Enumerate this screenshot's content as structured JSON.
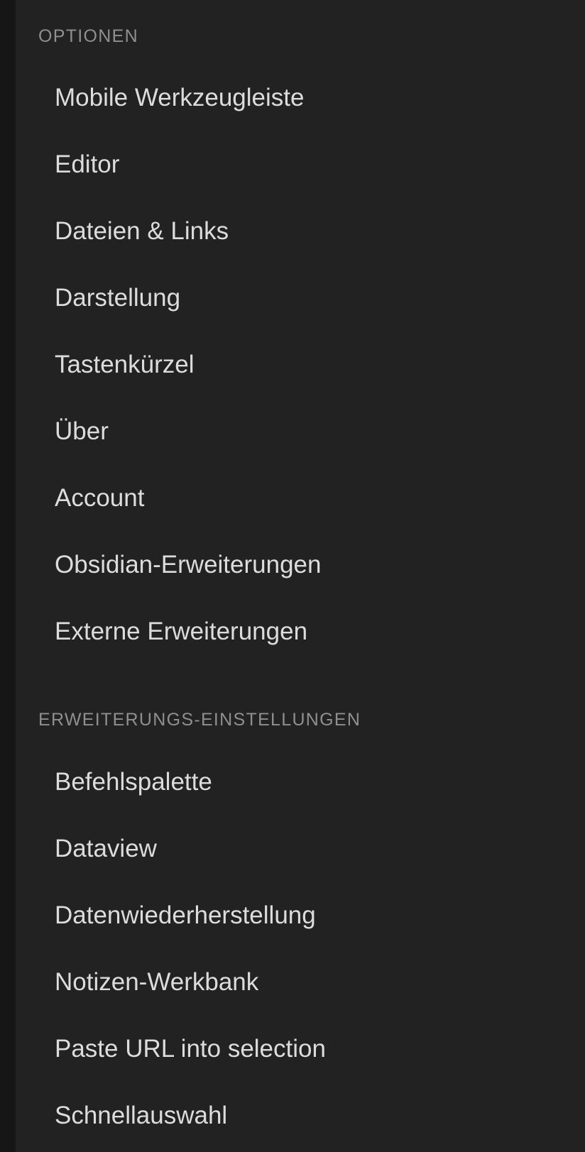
{
  "sections": [
    {
      "heading": "OPTIONEN",
      "items": [
        "Mobile Werkzeugleiste",
        "Editor",
        "Dateien & Links",
        "Darstellung",
        "Tastenkürzel",
        "Über",
        "Account",
        "Obsidian-Erweiterungen",
        "Externe Erweiterungen"
      ]
    },
    {
      "heading": "ERWEITERUNGS-EINSTELLUNGEN",
      "items": [
        "Befehlspalette",
        "Dataview",
        "Datenwiederherstellung",
        "Notizen-Werkbank",
        "Paste URL into selection",
        "Schnellauswahl"
      ]
    }
  ]
}
